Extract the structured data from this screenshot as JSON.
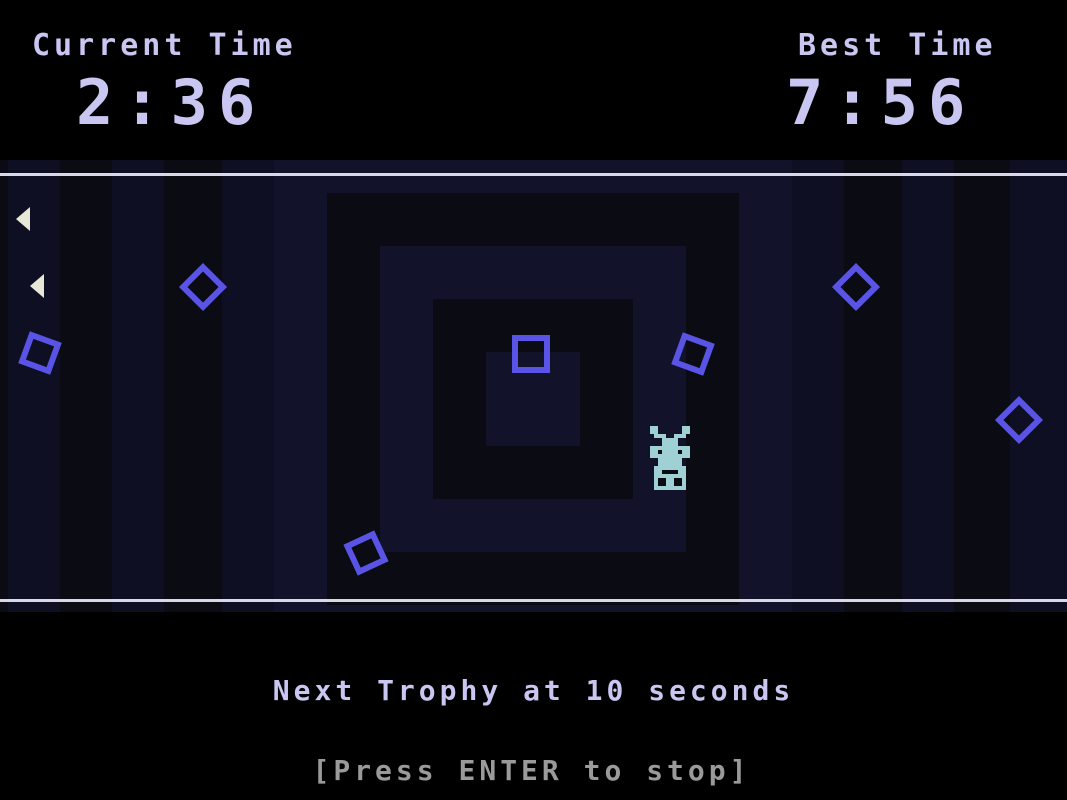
{
  "hud": {
    "current_time_label": "Current Time",
    "current_time_value": "2:36",
    "best_time_label": "Best Time",
    "best_time_value": "7:56"
  },
  "footer": {
    "trophy_message": "Next Trophy at 10 seconds",
    "instruction": "[Press ENTER to stop]"
  },
  "colors": {
    "hud_text": "#c9c6f2",
    "enemy": "#5a54e6",
    "player": "#9fd0d4",
    "instruction_text": "#9a9a9a",
    "arrow": "#e8e8d8"
  },
  "icons": {
    "enemy": "hollow-square-enemy-icon",
    "player": "crewmate-player-icon",
    "incoming": "left-arrow-warning-icon"
  }
}
